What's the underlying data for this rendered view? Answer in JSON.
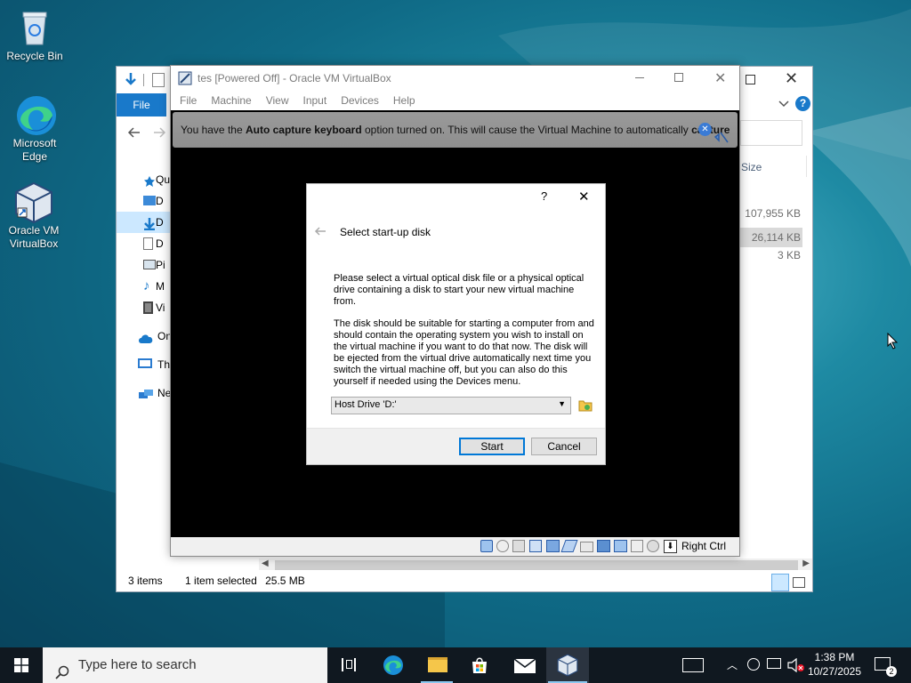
{
  "desktop": {
    "icons": [
      {
        "label": "Recycle Bin"
      },
      {
        "label": "Microsoft Edge"
      },
      {
        "label": "Oracle VM VirtualBox"
      }
    ]
  },
  "explorer": {
    "file_tab": "File",
    "sidebar": [
      {
        "label": "Qu"
      },
      {
        "label": "D"
      },
      {
        "label": "D"
      },
      {
        "label": "D"
      },
      {
        "label": "Pi"
      },
      {
        "label": "M"
      },
      {
        "label": "Vi"
      },
      {
        "label": "On"
      },
      {
        "label": "Thi"
      },
      {
        "label": "Ne"
      }
    ],
    "size_header": "Size",
    "sizes": [
      "107,955 KB",
      "26,114 KB",
      "3 KB"
    ],
    "status": {
      "items": "3 items",
      "selected": "1 item selected",
      "size": "25.5 MB"
    }
  },
  "vbox": {
    "title": "tes [Powered Off] - Oracle VM VirtualBox",
    "menu": [
      "File",
      "Machine",
      "View",
      "Input",
      "Devices",
      "Help"
    ],
    "notice": {
      "p1": "You have the ",
      "bold1": "Auto capture keyboard",
      "p2": " option turned on. This will cause the Virtual Machine to automatically ",
      "bold2": "capture"
    },
    "host_key": "Right Ctrl"
  },
  "dialog": {
    "help_glyph": "?",
    "close_glyph": "✕",
    "heading": "Select start-up disk",
    "para1": "Please select a virtual optical disk file or a physical optical drive containing a disk to start your new virtual machine from.",
    "para2": "The disk should be suitable for starting a computer from and should contain the operating system you wish to install on the virtual machine if you want to do that now. The disk will be ejected from the virtual drive automatically next time you switch the virtual machine off, but you can also do this yourself if needed using the Devices menu.",
    "drive_value": "Host Drive 'D:'",
    "start_label": "Start",
    "cancel_label": "Cancel"
  },
  "taskbar": {
    "search_placeholder": "Type here to search",
    "time": "1:38 PM",
    "date": "10/27/2025"
  }
}
